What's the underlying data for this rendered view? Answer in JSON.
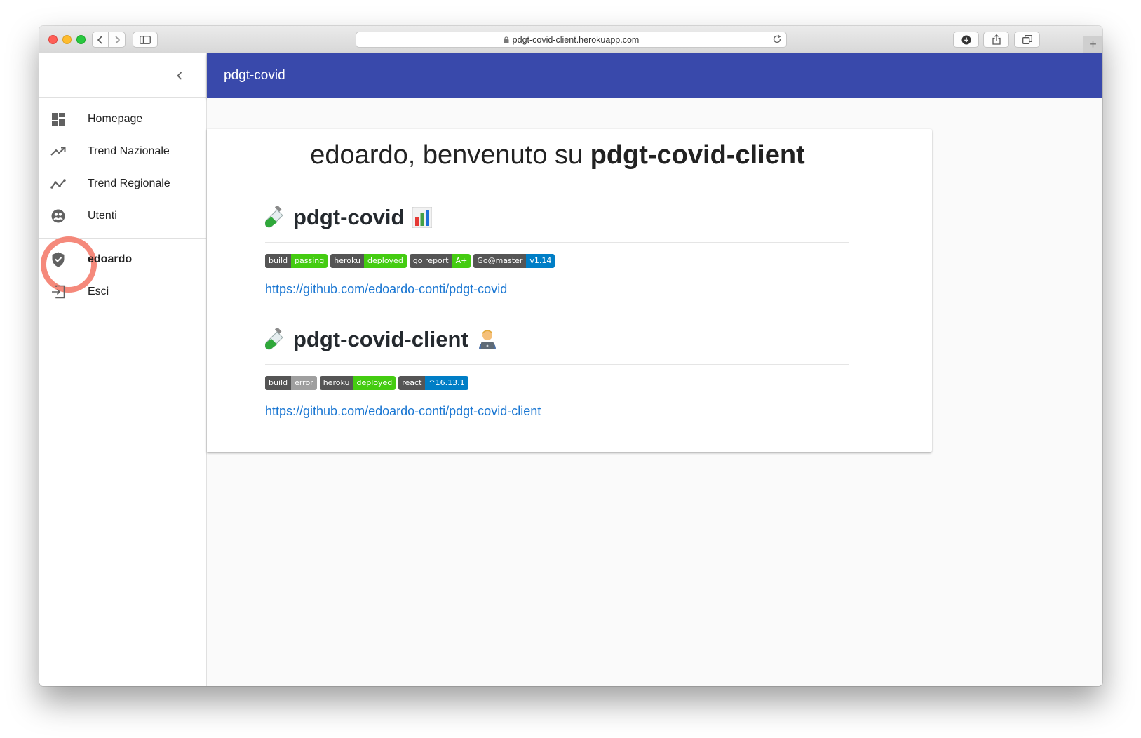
{
  "browser": {
    "url": "pdgt-covid-client.herokuapp.com"
  },
  "appbar": {
    "title": "pdgt-covid"
  },
  "sidebar": {
    "items": [
      {
        "label": "Homepage",
        "icon": "dashboard-icon"
      },
      {
        "label": "Trend Nazionale",
        "icon": "trending-up-icon"
      },
      {
        "label": "Trend Regionale",
        "icon": "timeline-icon"
      },
      {
        "label": "Utenti",
        "icon": "people-icon"
      }
    ],
    "user": {
      "label": "edoardo",
      "icon": "verified-shield-icon"
    },
    "logout": {
      "label": "Esci",
      "icon": "logout-icon"
    }
  },
  "main": {
    "welcome_prefix": "edoardo, benvenuto su ",
    "welcome_app": "pdgt-covid-client",
    "sections": [
      {
        "title": "pdgt-covid",
        "badges": [
          {
            "left": "build",
            "right": "passing",
            "color": "#4c1"
          },
          {
            "left": "heroku",
            "right": "deployed",
            "color": "#4c1"
          },
          {
            "left": "go report",
            "right": "A+",
            "color": "#4c1"
          },
          {
            "left": "Go@master",
            "right": "v1.14",
            "color": "#007ec6"
          }
        ],
        "link": "https://github.com/edoardo-conti/pdgt-covid"
      },
      {
        "title": "pdgt-covid-client",
        "badges": [
          {
            "left": "build",
            "right": "error",
            "color": "#9f9f9f"
          },
          {
            "left": "heroku",
            "right": "deployed",
            "color": "#4c1"
          },
          {
            "left": "react",
            "right": "^16.13.1",
            "color": "#007ec6"
          }
        ],
        "link": "https://github.com/edoardo-conti/pdgt-covid-client"
      }
    ]
  },
  "colors": {
    "appbar": "#3949ab",
    "link": "#1976d2",
    "highlight": "#f47c6d"
  }
}
